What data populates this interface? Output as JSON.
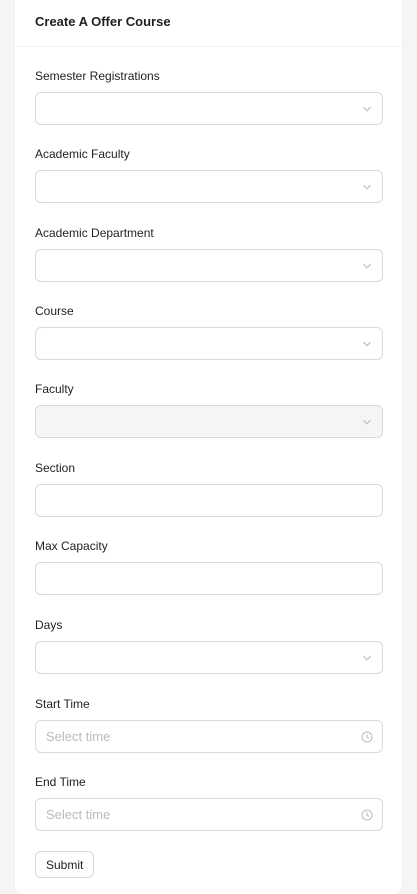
{
  "form": {
    "title": "Create A Offer Course",
    "fields": {
      "semester_registrations": {
        "label": "Semester Registrations",
        "value": ""
      },
      "academic_faculty": {
        "label": "Academic Faculty",
        "value": ""
      },
      "academic_department": {
        "label": "Academic Department",
        "value": ""
      },
      "course": {
        "label": "Course",
        "value": ""
      },
      "faculty": {
        "label": "Faculty",
        "value": "",
        "disabled": true
      },
      "section": {
        "label": "Section",
        "value": ""
      },
      "max_capacity": {
        "label": "Max Capacity",
        "value": ""
      },
      "days": {
        "label": "Days",
        "value": ""
      },
      "start_time": {
        "label": "Start Time",
        "placeholder": "Select time"
      },
      "end_time": {
        "label": "End Time",
        "placeholder": "Select time"
      }
    },
    "submit_label": "Submit"
  },
  "icons": {
    "select_suffix": "chevron-down-icon",
    "time_suffix": "clock-icon"
  },
  "colors": {
    "background": "#f5f5f5",
    "card": "#ffffff",
    "border": "#d9d9d9",
    "disabled": "#f5f5f5",
    "placeholder": "#bfbfbf"
  }
}
